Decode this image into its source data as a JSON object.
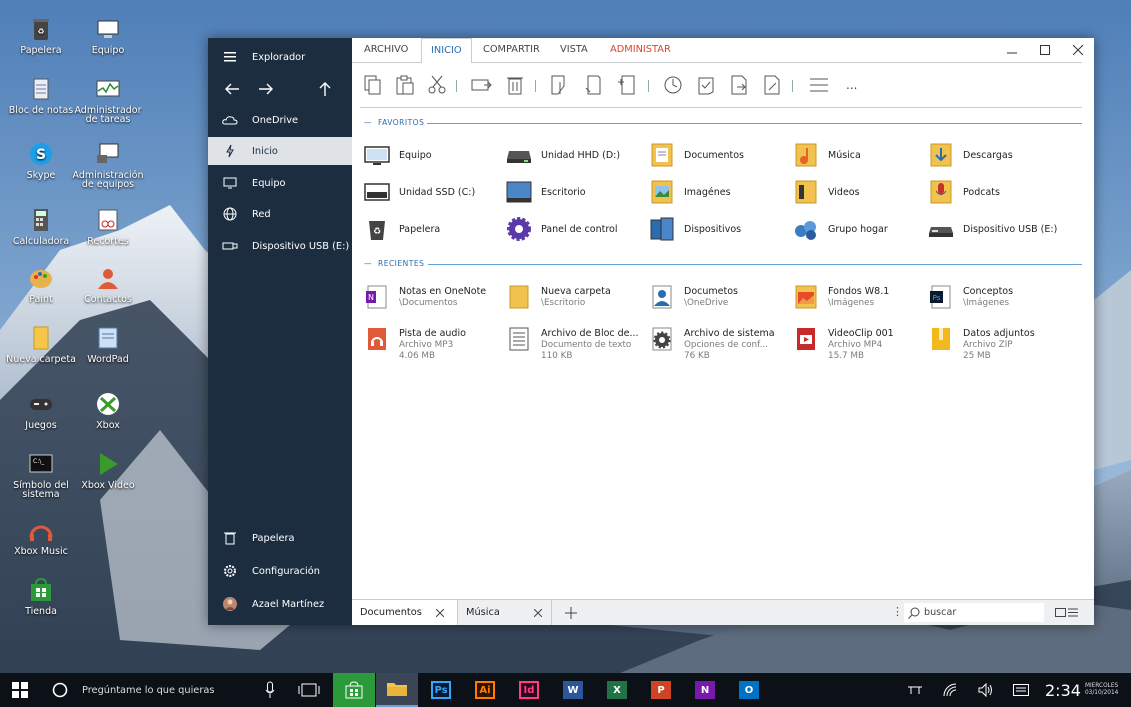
{
  "desktop_icons": [
    {
      "label": "Papelera",
      "icon": "recycle-bin-icon"
    },
    {
      "label": "Equipo",
      "icon": "computer-icon"
    },
    {
      "label": "Bloc de notas",
      "icon": "notepad-icon"
    },
    {
      "label": "Administrador de tareas",
      "icon": "task-manager-icon"
    },
    {
      "label": "Skype",
      "icon": "skype-icon"
    },
    {
      "label": "Administración de equipos",
      "icon": "computer-management-icon"
    },
    {
      "label": "Calculadora",
      "icon": "calculator-icon"
    },
    {
      "label": "Recortes",
      "icon": "snipping-tool-icon"
    },
    {
      "label": "Paint",
      "icon": "paint-icon"
    },
    {
      "label": "Contactos",
      "icon": "contacts-icon"
    },
    {
      "label": "Nueva carpeta",
      "icon": "folder-icon"
    },
    {
      "label": "WordPad",
      "icon": "wordpad-icon"
    },
    {
      "label": "Juegos",
      "icon": "gamepad-icon"
    },
    {
      "label": "Xbox",
      "icon": "xbox-icon"
    },
    {
      "label": "Símbolo del sistema",
      "icon": "command-prompt-icon"
    },
    {
      "label": "Xbox Video",
      "icon": "xbox-video-icon"
    },
    {
      "label": "Xbox Music",
      "icon": "xbox-music-icon"
    },
    {
      "label": "Tienda",
      "icon": "store-icon"
    }
  ],
  "nav": {
    "title": "Explorador",
    "items": [
      "OneDrive",
      "Inicio",
      "Equipo",
      "Red",
      "Dispositivo USB (E:)"
    ],
    "bottom": [
      "Papelera",
      "Configuración",
      "Azael Martínez"
    ]
  },
  "ribbon_tabs": [
    "ARCHIVO",
    "INICIO",
    "COMPARTIR",
    "VISTA",
    "ADMINISTAR"
  ],
  "ribbon_more": "...",
  "favoritos": {
    "header": "FAVORITOS",
    "items": [
      "Equipo",
      "Unidad HHD (D:)",
      "Documentos",
      "Música",
      "Descargas",
      "Unidad SSD (C:)",
      "Escritorio",
      "Imagénes",
      "Videos",
      "Podcats",
      "Papelera",
      "Panel de control",
      "Dispositivos",
      "Grupo hogar",
      "Dispositivo USB (E:)"
    ]
  },
  "recientes": {
    "header": "RECIENTES",
    "items": [
      {
        "name": "Notas en OneNote",
        "sub": "\\Documentos",
        "sub2": ""
      },
      {
        "name": "Nueva carpeta",
        "sub": "\\Escritorio",
        "sub2": ""
      },
      {
        "name": "Documetos",
        "sub": "\\OneDrive",
        "sub2": ""
      },
      {
        "name": "Fondos W8.1",
        "sub": "\\Imágenes",
        "sub2": ""
      },
      {
        "name": "Conceptos",
        "sub": "\\Imágenes",
        "sub2": ""
      },
      {
        "name": "Pista de audio",
        "sub": "Archivo MP3",
        "sub2": "4.06 MB"
      },
      {
        "name": "Archivo de Bloc de...",
        "sub": "Documento de texto",
        "sub2": "110 KB"
      },
      {
        "name": "Archivo de sistema",
        "sub": "Opciones de conf...",
        "sub2": "76 KB"
      },
      {
        "name": "VideoClip 001",
        "sub": "Archivo MP4",
        "sub2": "15.7 MB"
      },
      {
        "name": "Datos adjuntos",
        "sub": "Archivo ZIP",
        "sub2": "25 MB"
      }
    ]
  },
  "bottom_tabs": [
    "Documentos",
    "Música"
  ],
  "search": {
    "placeholder": "buscar"
  },
  "taskbar": {
    "cortana": "Pregúntame lo que quieras",
    "apps": [
      {
        "label": "Ps",
        "color": "#31a8ff",
        "bg": "#0a1a2e"
      },
      {
        "label": "Ai",
        "color": "#ff7c00",
        "bg": "#2b1400"
      },
      {
        "label": "Id",
        "color": "#ff3d8b",
        "bg": "#2b0a18"
      },
      {
        "label": "W",
        "color": "#ffffff",
        "bg": "#2b579a"
      },
      {
        "label": "X",
        "color": "#ffffff",
        "bg": "#217346"
      },
      {
        "label": "P",
        "color": "#ffffff",
        "bg": "#d04423"
      },
      {
        "label": "N",
        "color": "#ffffff",
        "bg": "#7719aa"
      },
      {
        "label": "O",
        "color": "#ffffff",
        "bg": "#0072c6"
      }
    ],
    "time": "2:34",
    "day": "MIERCOLES",
    "date": "03/10/2014"
  }
}
